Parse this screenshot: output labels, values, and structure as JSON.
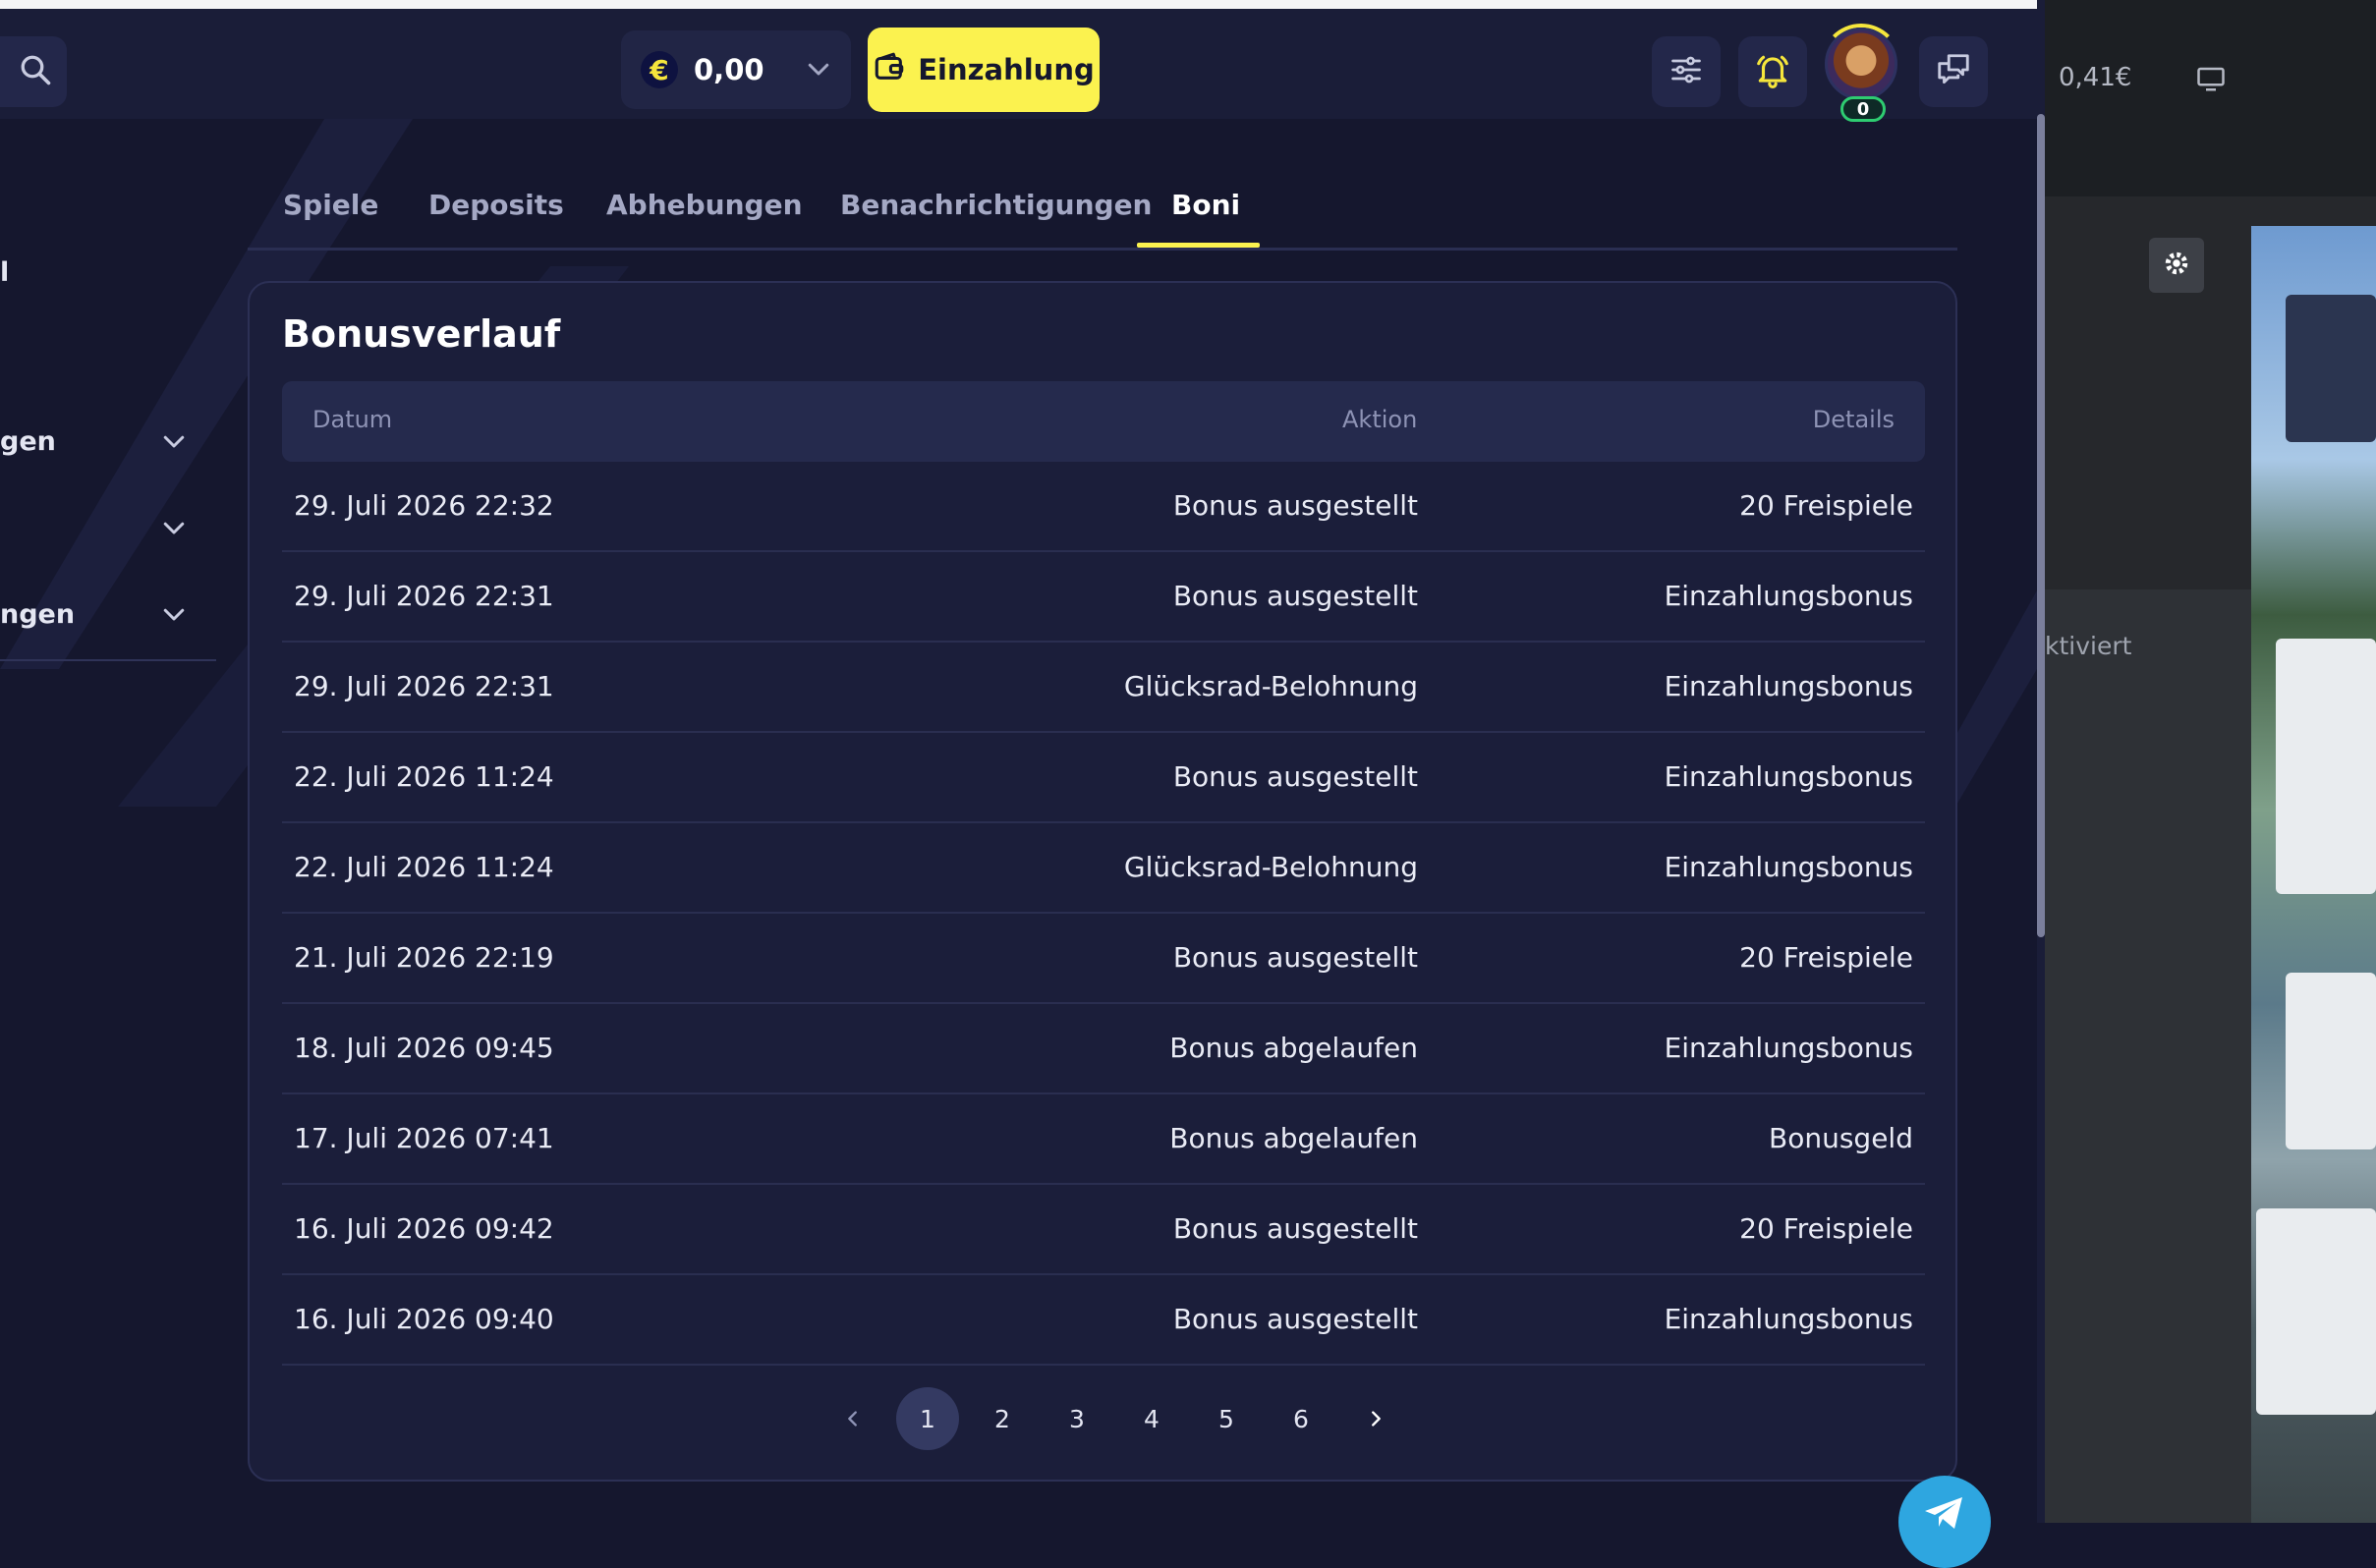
{
  "header": {
    "balance": "0,00",
    "currency_symbol": "€",
    "deposit_label": "Einzahlung",
    "level": "0"
  },
  "sidebar": {
    "items": [
      {
        "label": "l"
      },
      {
        "label": "gen"
      },
      {
        "label": ""
      },
      {
        "label": "ngen"
      }
    ]
  },
  "tabs": [
    {
      "label": "Spiele"
    },
    {
      "label": "Deposits"
    },
    {
      "label": "Abhebungen"
    },
    {
      "label": "Benachrichtigungen"
    },
    {
      "label": "Boni",
      "active": true
    }
  ],
  "panel": {
    "title": "Bonusverlauf",
    "columns": {
      "date": "Datum",
      "action": "Aktion",
      "details": "Details"
    },
    "rows": [
      {
        "date": "29. Juli 2026 22:32",
        "action": "Bonus ausgestellt",
        "details": "20 Freispiele"
      },
      {
        "date": "29. Juli 2026 22:31",
        "action": "Bonus ausgestellt",
        "details": "Einzahlungsbonus"
      },
      {
        "date": "29. Juli 2026 22:31",
        "action": "Glücksrad-Belohnung",
        "details": "Einzahlungsbonus"
      },
      {
        "date": "22. Juli 2026 11:24",
        "action": "Bonus ausgestellt",
        "details": "Einzahlungsbonus"
      },
      {
        "date": "22. Juli 2026 11:24",
        "action": "Glücksrad-Belohnung",
        "details": "Einzahlungsbonus"
      },
      {
        "date": "21. Juli 2026 22:19",
        "action": "Bonus ausgestellt",
        "details": "20 Freispiele"
      },
      {
        "date": "18. Juli 2026 09:45",
        "action": "Bonus abgelaufen",
        "details": "Einzahlungsbonus"
      },
      {
        "date": "17. Juli 2026 07:41",
        "action": "Bonus abgelaufen",
        "details": "Bonusgeld"
      },
      {
        "date": "16. Juli 2026 09:42",
        "action": "Bonus ausgestellt",
        "details": "20 Freispiele"
      },
      {
        "date": "16. Juli 2026 09:40",
        "action": "Bonus ausgestellt",
        "details": "Einzahlungsbonus"
      }
    ]
  },
  "pagination": {
    "pages": [
      "1",
      "2",
      "3",
      "4",
      "5",
      "6"
    ],
    "current": "1"
  },
  "other_window": {
    "balance": "0,41€",
    "status_text": "ktiviert"
  },
  "colors": {
    "accent": "#fbf24f",
    "background": "#15172e",
    "panel": "#1b1e3a",
    "telegram": "#2ea6e0",
    "level_badge": "#2ecc71"
  }
}
